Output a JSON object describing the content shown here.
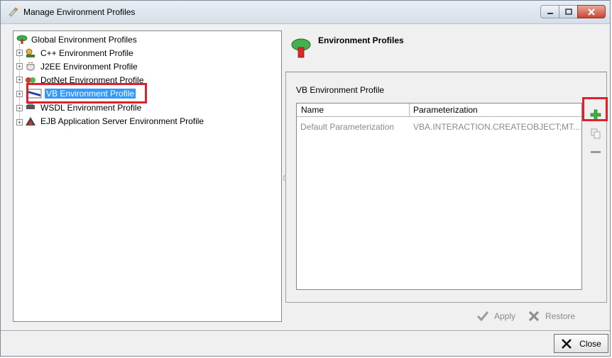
{
  "window": {
    "title": "Manage Environment Profiles"
  },
  "tree": {
    "root_label": "Global Environment Profiles",
    "items": [
      {
        "label": "C++ Environment Profile",
        "icon": "cpp-profile-icon"
      },
      {
        "label": "J2EE Environment Profile",
        "icon": "j2ee-profile-icon"
      },
      {
        "label": "DotNet Environment Profile",
        "icon": "dotnet-profile-icon"
      },
      {
        "label": "VB Environment Profile",
        "icon": "vb-profile-icon",
        "selected": true
      },
      {
        "label": "WSDL Environment Profile",
        "icon": "wsdl-profile-icon"
      },
      {
        "label": "EJB Application Server Environment Profile",
        "icon": "ejb-profile-icon"
      }
    ]
  },
  "panel": {
    "header_title": "Environment Profiles",
    "profile_name": "VB Environment Profile",
    "table": {
      "columns": [
        "Name",
        "Parameterization"
      ],
      "rows": [
        {
          "name": "Default Parameterization",
          "parameterization": "VBA.INTERACTION.CREATEOBJECT;MT..."
        }
      ]
    },
    "apply_label": "Apply",
    "restore_label": "Restore"
  },
  "footer": {
    "close_label": "Close"
  },
  "colors": {
    "selection": "#3399ff",
    "highlight_box": "#e0202a",
    "add_icon": "#3cb043"
  }
}
